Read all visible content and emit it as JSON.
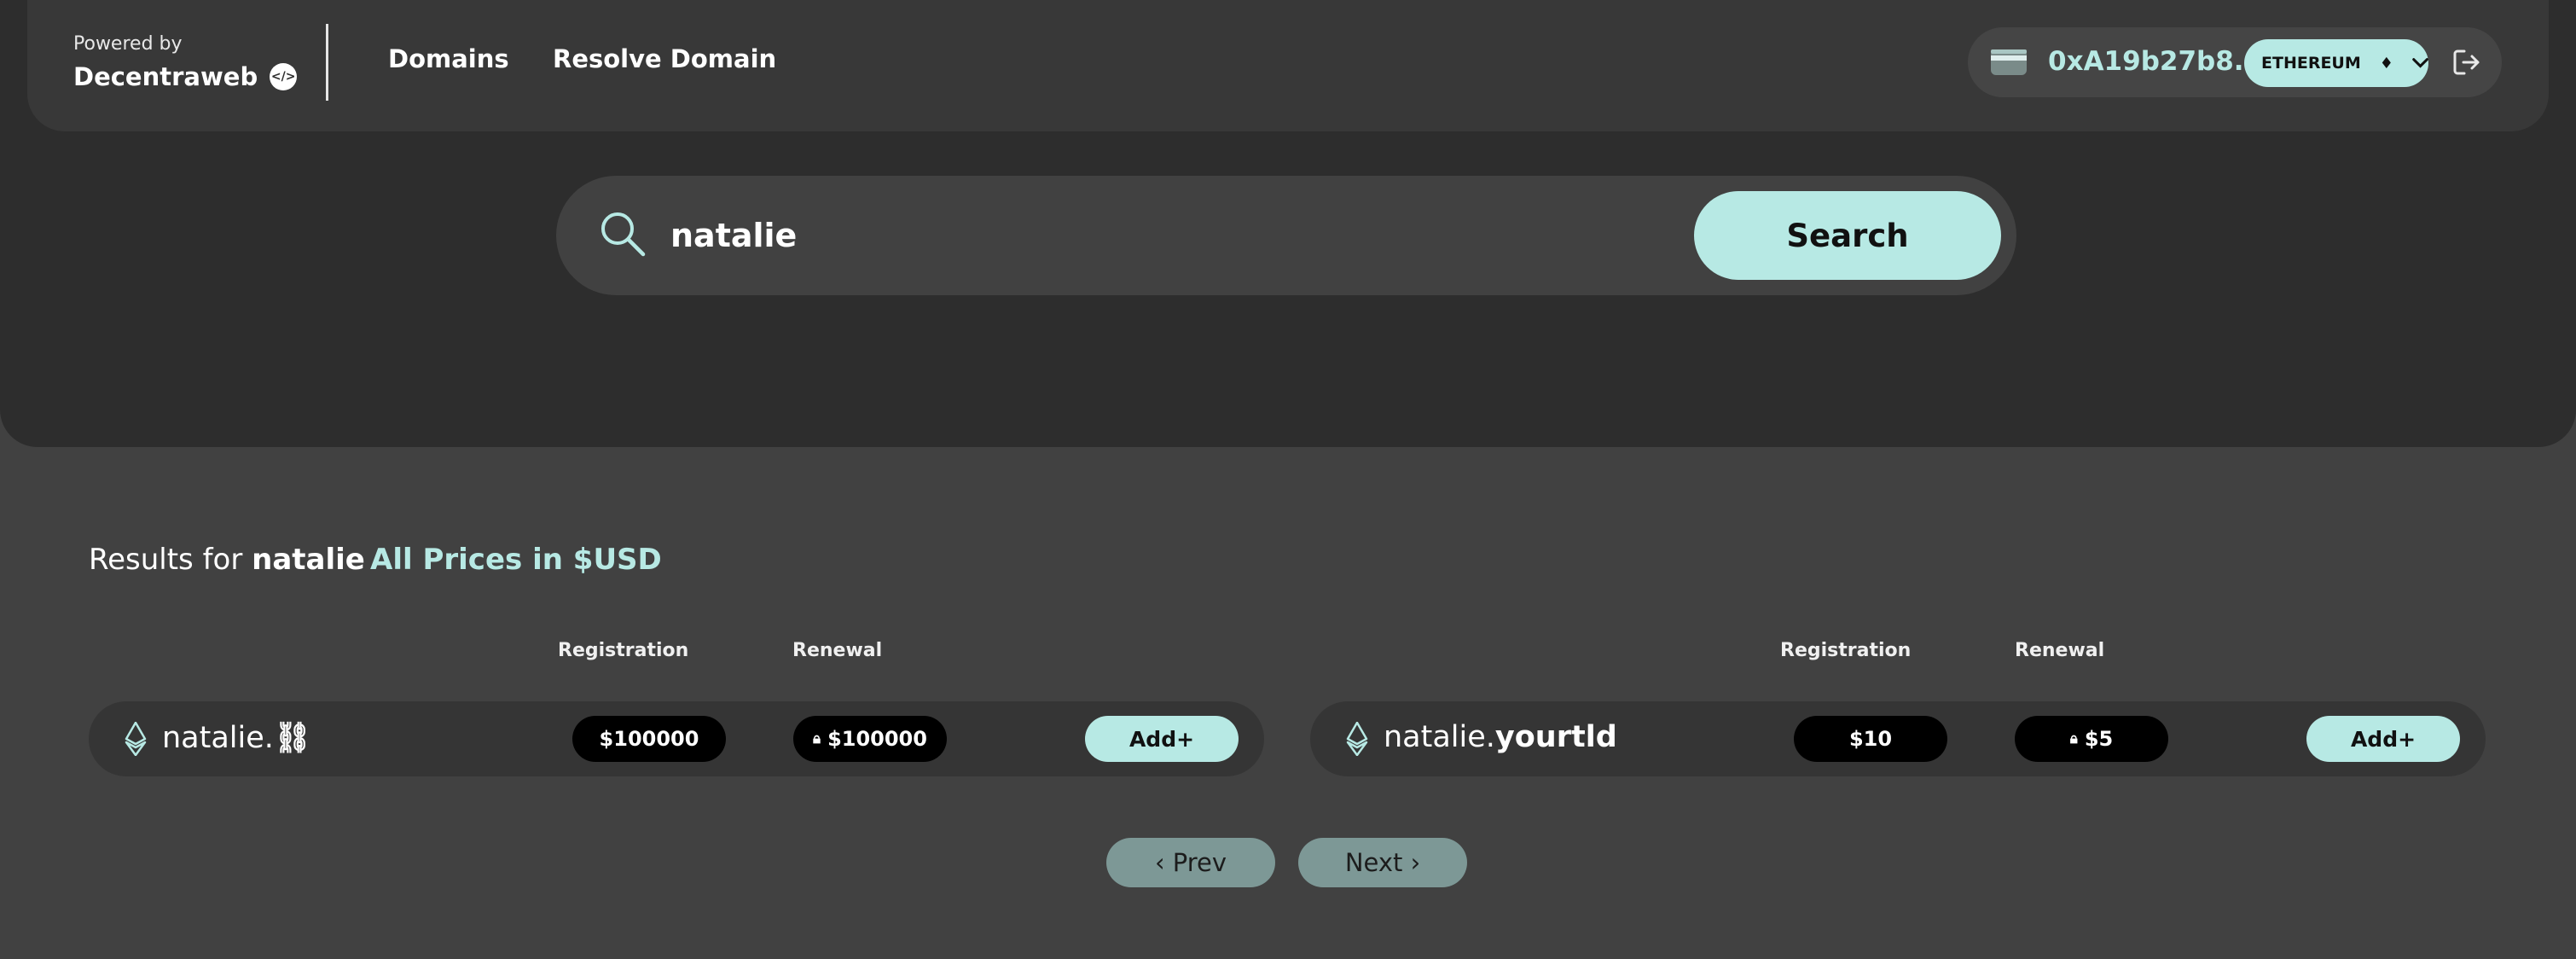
{
  "header": {
    "powered_by": "Powered by",
    "brand": "Decentraweb",
    "brand_badge": "</>",
    "nav": [
      "Domains",
      "Resolve Domain"
    ],
    "wallet_address": "0xA19b27b8...",
    "chain": "ETHEREUM"
  },
  "search": {
    "value": "natalie",
    "button": "Search"
  },
  "results": {
    "prefix": "Results for",
    "query": "natalie",
    "prices_note": "All Prices in $USD",
    "col_registration": "Registration",
    "col_renewal": "Renewal",
    "items": [
      {
        "name": "natalie.",
        "tld": "⛓",
        "registration": "$100000",
        "renewal": "$100000",
        "add_label": "Add+"
      },
      {
        "name": "natalie.",
        "tld": "yourtld",
        "registration": "$10",
        "renewal": "$5",
        "add_label": "Add+"
      }
    ]
  },
  "pagination": {
    "prev": "‹ Prev",
    "next": "Next ›"
  },
  "colors": {
    "accent": "#b7e9e4",
    "hero_bg": "#2d2d2d",
    "page_bg": "#414141",
    "pill_bg": "#000000",
    "page_btn": "#7d9896"
  }
}
